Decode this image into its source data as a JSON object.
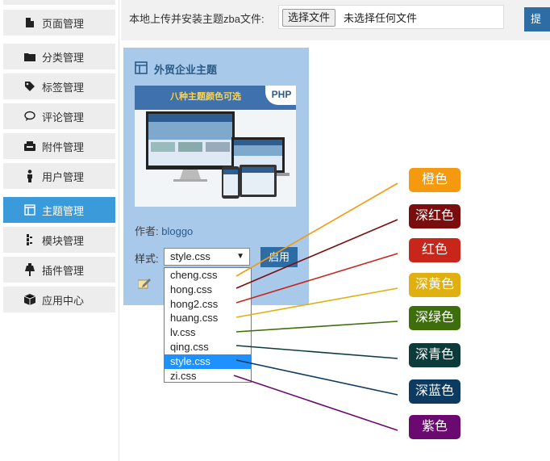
{
  "sidebar": {
    "items": [
      {
        "label": "页面管理",
        "icon": "page-icon"
      },
      {
        "label": "分类管理",
        "icon": "folder-icon"
      },
      {
        "label": "标签管理",
        "icon": "tag-icon"
      },
      {
        "label": "评论管理",
        "icon": "comment-icon"
      },
      {
        "label": "附件管理",
        "icon": "attachment-icon"
      },
      {
        "label": "用户管理",
        "icon": "user-icon"
      },
      {
        "label": "主题管理",
        "icon": "theme-icon"
      },
      {
        "label": "模块管理",
        "icon": "module-icon"
      },
      {
        "label": "插件管理",
        "icon": "plugin-icon"
      },
      {
        "label": "应用中心",
        "icon": "box-icon"
      }
    ],
    "active_index": 6
  },
  "upload": {
    "label": "本地上传并安装主题zba文件:",
    "choose_button": "选择文件",
    "no_file": "未选择任何文件",
    "submit_label": "提"
  },
  "theme": {
    "title": "外贸企业主题",
    "thumbnail": {
      "headline": "八种主题颜色可选",
      "badge": "PHP"
    },
    "author_label": "作者:",
    "author": "bloggo",
    "style_label": "样式:",
    "selected_style": "style.css",
    "apply_label": "启用",
    "styles": [
      "cheng.css",
      "hong.css",
      "hong2.css",
      "huang.css",
      "lv.css",
      "qing.css",
      "style.css",
      "zi.css"
    ],
    "selected_index": 6
  },
  "annotations": [
    {
      "label": "橙色",
      "color": "#f59a0e"
    },
    {
      "label": "深红色",
      "color": "#7a0e0e"
    },
    {
      "label": "红色",
      "color": "#c9261b"
    },
    {
      "label": "深黄色",
      "color": "#e0b010"
    },
    {
      "label": "深绿色",
      "color": "#3e6d0c"
    },
    {
      "label": "深青色",
      "color": "#0c3b3b"
    },
    {
      "label": "深蓝色",
      "color": "#0d3a60"
    },
    {
      "label": "紫色",
      "color": "#6a0a70"
    }
  ],
  "colors": {
    "accent": "#3b9ad9",
    "card_bg": "#a8c9ea",
    "button": "#2e6da4"
  }
}
